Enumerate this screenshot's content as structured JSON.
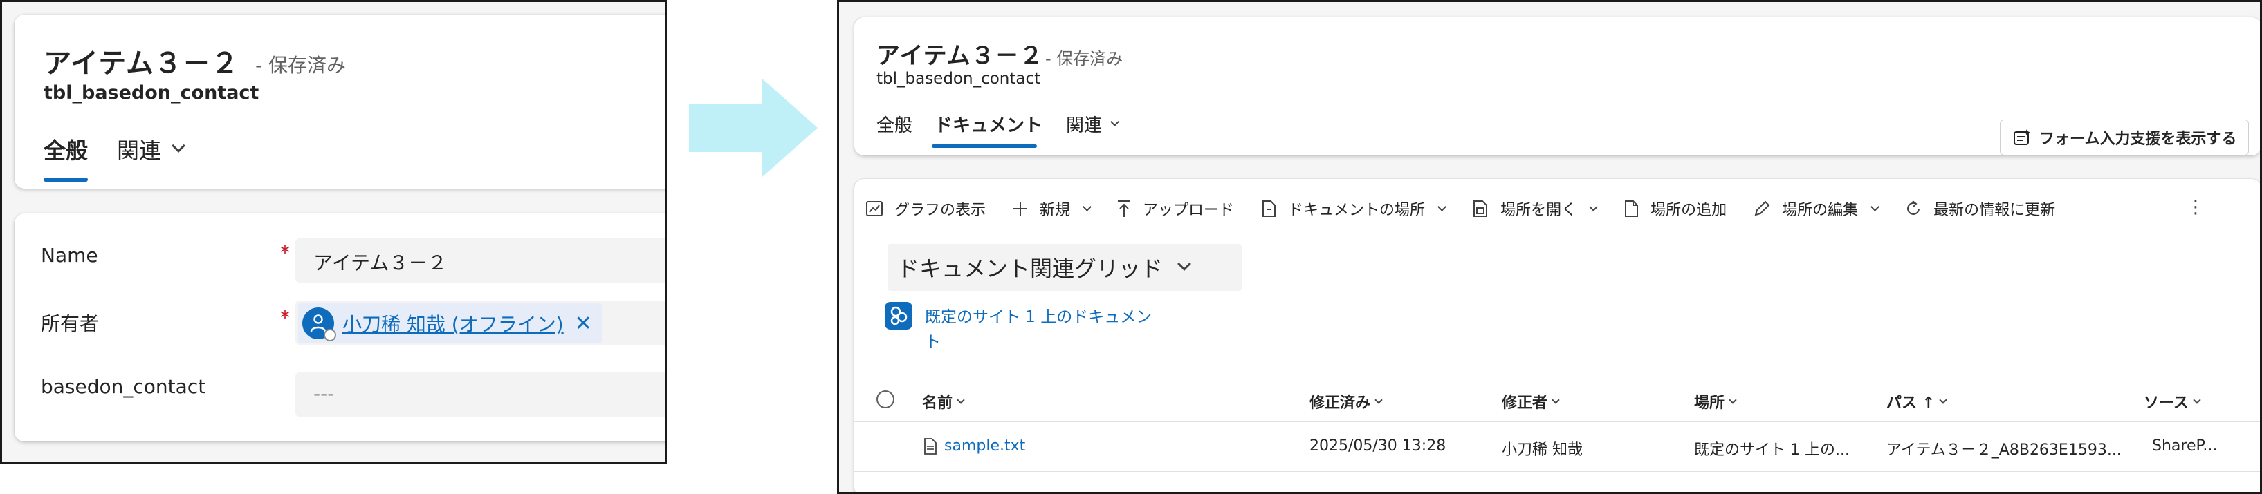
{
  "left_form": {
    "title": "アイテム３－２",
    "saved_status": "- 保存済み",
    "entity_name": "tbl_basedon_contact",
    "tabs": [
      {
        "label": "全般",
        "active": true
      },
      {
        "label": "関連",
        "active": false
      }
    ],
    "fields": {
      "name": {
        "label": "Name",
        "required": "*",
        "value": "アイテム３－２"
      },
      "owner": {
        "label": "所有者",
        "required": "*",
        "value": "小刀稀 知哉 (オフライン)",
        "remove": "✕"
      },
      "basedon_contact": {
        "label": "basedon_contact",
        "value": "---"
      }
    }
  },
  "right_form": {
    "title": "アイテム３－２",
    "saved_status": "- 保存済み",
    "entity_name": "tbl_basedon_contact",
    "tabs": [
      {
        "label": "全般",
        "active": false
      },
      {
        "label": "ドキュメント",
        "active": true
      },
      {
        "label": "関連",
        "active": false
      }
    ],
    "form_assist_button": "フォーム入力支援を表示する",
    "commands": [
      {
        "label": "グラフの表示",
        "icon": "chart-icon"
      },
      {
        "label": "新規",
        "icon": "plus-icon",
        "dropdown": true
      },
      {
        "label": "アップロード",
        "icon": "upload-icon"
      },
      {
        "label": "ドキュメントの場所",
        "icon": "document-icon",
        "dropdown": true
      },
      {
        "label": "場所を開く",
        "icon": "open-location-icon",
        "dropdown": true
      },
      {
        "label": "場所の追加",
        "icon": "add-location-icon"
      },
      {
        "label": "場所の編集",
        "icon": "edit-icon",
        "dropdown": true
      },
      {
        "label": "最新の情報に更新",
        "icon": "refresh-icon"
      }
    ],
    "more": "⋮",
    "view_selector": "ドキュメント関連グリッド",
    "sharepoint_location": "既定のサイト 1 上のドキュメント",
    "grid": {
      "columns": [
        "名前",
        "修正済み",
        "修正者",
        "場所",
        "パス ↑",
        "ソース"
      ],
      "rows": [
        {
          "name": "sample.txt",
          "modified": "2025/05/30 13:28",
          "modified_by": "小刀稀 知哉",
          "location": "既定のサイト 1 上の...",
          "path": "アイテム３－２_A8B263E1593...",
          "source": "ShareP..."
        }
      ]
    }
  },
  "colors": {
    "accent": "#0f6cbd",
    "arrow": "#bff0f8",
    "required": "#c50f1f",
    "frame_background": "#f5f5f5"
  }
}
